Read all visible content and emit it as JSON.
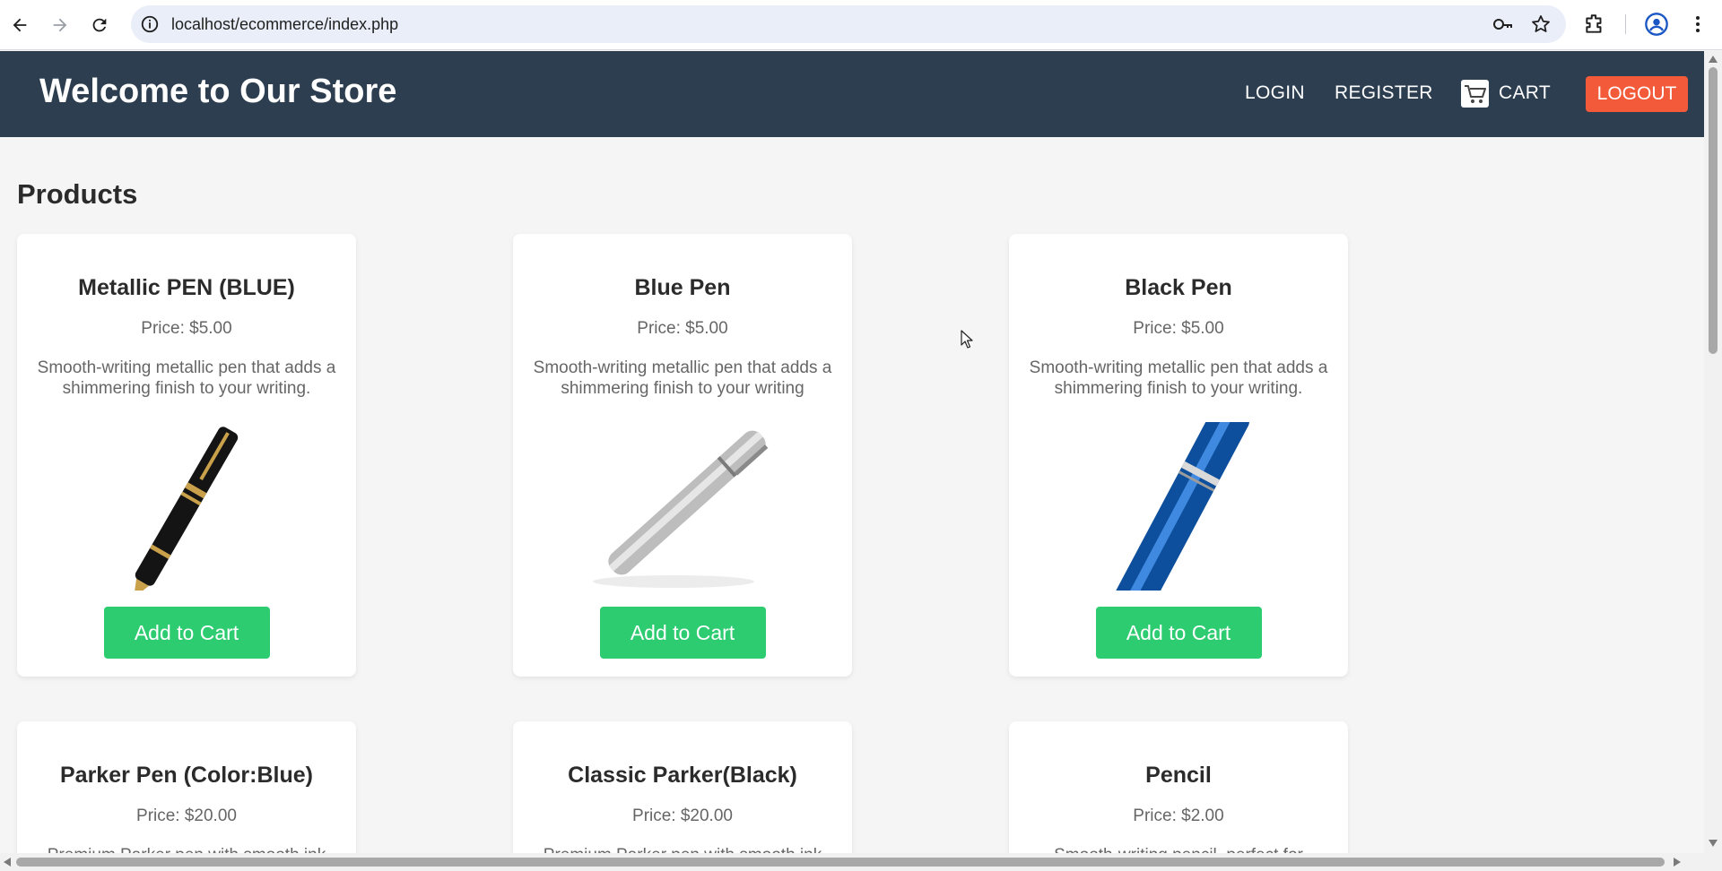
{
  "browser": {
    "url": "localhost/ecommerce/index.php"
  },
  "header": {
    "title": "Welcome to Our Store",
    "nav": {
      "login": "LOGIN",
      "register": "REGISTER",
      "cart": "CART",
      "logout": "LOGOUT"
    }
  },
  "main": {
    "section_title": "Products",
    "products": [
      {
        "name": "Metallic PEN (BLUE)",
        "price": "Price: $5.00",
        "description": "Smooth-writing metallic pen that adds a shimmering finish to your writing.",
        "button": "Add to Cart"
      },
      {
        "name": "Blue Pen",
        "price": "Price: $5.00",
        "description": "Smooth-writing metallic pen that adds a shimmering finish to your writing",
        "button": "Add to Cart"
      },
      {
        "name": "Black Pen",
        "price": "Price: $5.00",
        "description": "Smooth-writing metallic pen that adds a shimmering finish to your writing.",
        "button": "Add to Cart"
      },
      {
        "name": "Parker Pen (Color:Blue)",
        "price": "Price: $20.00",
        "description": "Premium Parker pen with smooth ink"
      },
      {
        "name": "Classic Parker(Black)",
        "price": "Price: $20.00",
        "description": "Premium Parker pen with smooth ink"
      },
      {
        "name": "Pencil",
        "price": "Price: $2.00",
        "description": "Smooth-writing pencil, perfect for"
      }
    ]
  },
  "colors": {
    "header_bg": "#2c3e50",
    "logout_bg": "#f25a3a",
    "button_green": "#2ecc71",
    "page_bg": "#f5f5f5"
  },
  "icons": [
    "back-icon",
    "forward-icon",
    "reload-icon",
    "site-info-icon",
    "password-key-icon",
    "bookmark-star-icon",
    "extensions-icon",
    "profile-icon",
    "menu-kebab-icon",
    "cart-icon",
    "mouse-cursor-icon"
  ]
}
